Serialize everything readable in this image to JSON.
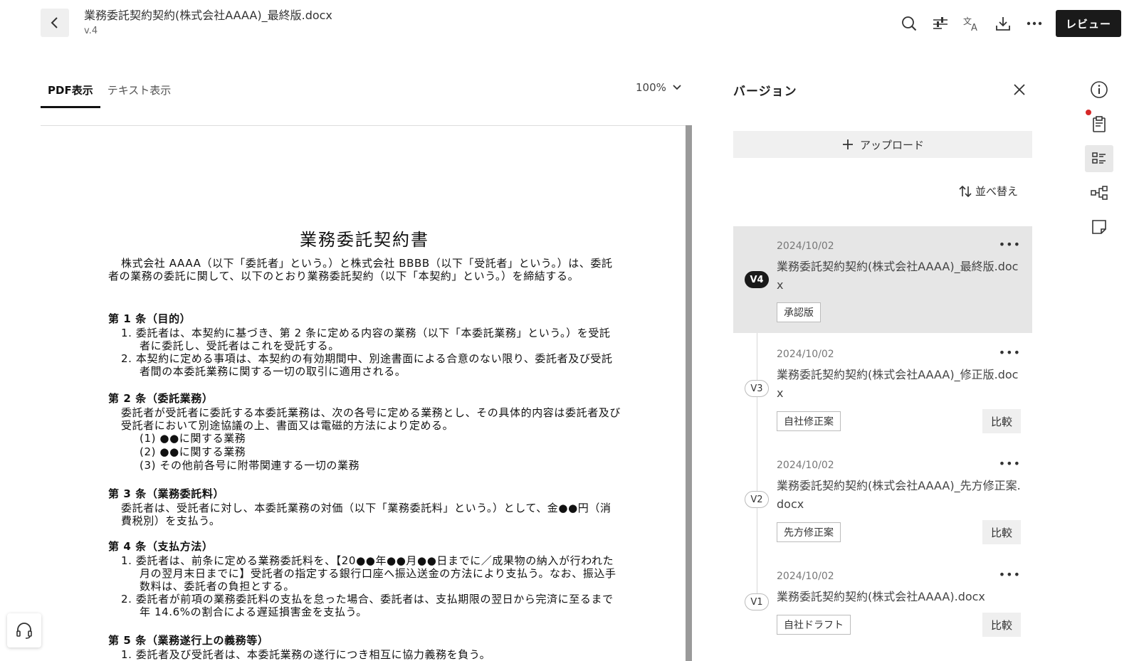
{
  "header": {
    "title": "業務委託契約契約(株式会社AAAA)_最終版.docx",
    "version": "v.4",
    "review_label": "レビュー"
  },
  "toolbar_icons": [
    "search-icon",
    "adjust-icon",
    "translate-icon",
    "download-icon",
    "more-icon"
  ],
  "tabs": [
    {
      "label": "PDF表示",
      "active": true
    },
    {
      "label": "テキスト表示",
      "active": false
    }
  ],
  "zoom": "100%",
  "document": {
    "title": "業務委託契約書",
    "intro": "株式会社 AAAA（以下「委託者」という。）と株式会社 BBBB（以下「受託者」という。）は、委託者の業務の委託に関して、以下のとおり業務委託契約（以下「本契約」という。）を締結する。",
    "a1_title": "第 1 条（目的）",
    "a1_i1": "1. 委託者は、本契約に基づき、第 2 条に定める内容の業務（以下「本委託業務」という。）を受託者に委託し、受託者はこれを受託する。",
    "a1_i2": "2. 本契約に定める事項は、本契約の有効期間中、別途書面による合意のない限り、委託者及び受託者間の本委託業務に関する一切の取引に適用される。",
    "a2_title": "第 2 条（委託業務）",
    "a2_body": "委託者が受託者に委託する本委託業務は、次の各号に定める業務とし、その具体的内容は委託者及び受託者において別途協議の上、書面又は電磁的方法により定める。",
    "a2_i1": "(1) ●●に関する業務",
    "a2_i2": "(2) ●●に関する業務",
    "a2_i3": "(3) その他前各号に附帯関連する一切の業務",
    "a3_title": "第 3 条（業務委託料）",
    "a3_body": "委託者は、受託者に対し、本委託業務の対価（以下「業務委託料」という。）として、金●●円（消費税別）を支払う。",
    "a4_title": "第 4 条（支払方法）",
    "a4_i1": "1. 委託者は、前条に定める業務委託料を、【20●●年●●月●●日までに／成果物の納入が行われた月の翌月末日までに】受託者の指定する銀行口座へ振込送金の方法により支払う。なお、振込手数料は、委託者の負担とする。",
    "a4_i2": "2. 委託者が前項の業務委託料の支払を怠った場合、委託者は、支払期限の翌日から完済に至るまで年 14.6%の割合による遅延損害金を支払う。",
    "a5_title": "第 5 条（業務遂行上の義務等）",
    "a5_i1": "1. 委託者及び受託者は、本委託業務の遂行につき相互に協力義務を負う。"
  },
  "panel": {
    "title": "バージョン",
    "upload_label": "アップロード",
    "sort_label": "並べ替え",
    "versions": [
      {
        "badge": "V4",
        "date": "2024/10/02",
        "name": "業務委託契約契約(株式会社AAAA)_最終版.docx",
        "tag": "承認版",
        "compare": ""
      },
      {
        "badge": "V3",
        "date": "2024/10/02",
        "name": "業務委託契約契約(株式会社AAAA)_修正版.docx",
        "tag": "自社修正案",
        "compare": "比較"
      },
      {
        "badge": "V2",
        "date": "2024/10/02",
        "name": "業務委託契約契約(株式会社AAAA)_先方修正案.docx",
        "tag": "先方修正案",
        "compare": "比較"
      },
      {
        "badge": "V1",
        "date": "2024/10/02",
        "name": "業務委託契約契約(株式会社AAAA).docx",
        "tag": "自社ドラフト",
        "compare": "比較"
      }
    ]
  },
  "rail_icons": [
    "info-icon",
    "clipboard-icon",
    "list-icon",
    "flow-icon",
    "note-icon"
  ]
}
